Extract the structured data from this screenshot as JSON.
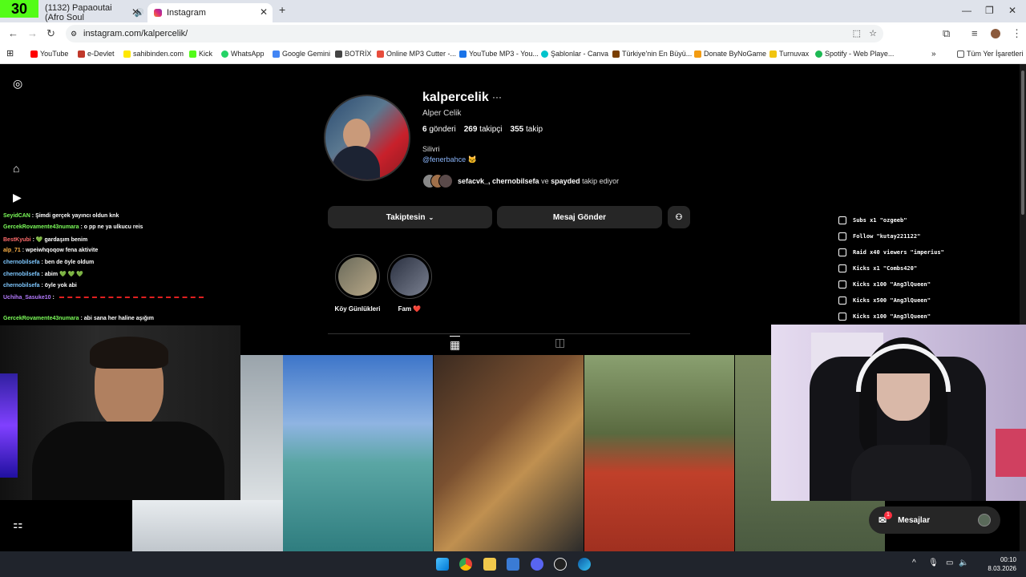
{
  "browser": {
    "k30_badge": "30",
    "tabs": [
      {
        "title": "(1132) Papaoutai (Afro Soul"
      },
      {
        "title": "Instagram"
      }
    ],
    "new_tab": "+",
    "url": "instagram.com/kalpercelik/",
    "bookmarks": [
      {
        "label": "YouTube",
        "color": "#ff0000"
      },
      {
        "label": "e-Devlet",
        "color": "#c0392b"
      },
      {
        "label": "sahibinden.com",
        "color": "#ffe800"
      },
      {
        "label": "Kick",
        "color": "#53fc18"
      },
      {
        "label": "WhatsApp",
        "color": "#25d366"
      },
      {
        "label": "Google Gemini",
        "color": "#4285f4"
      },
      {
        "label": "BOTRİX",
        "color": "#444444"
      },
      {
        "label": "Online MP3 Cutter -...",
        "color": "#e74c3c"
      },
      {
        "label": "YouTube MP3 - You...",
        "color": "#1a73e8"
      },
      {
        "label": "Şablonlar - Canva",
        "color": "#00c4cc"
      },
      {
        "label": "Türkiye'nin En Büyü...",
        "color": "#7b3f00"
      },
      {
        "label": "Donate ByNoGame",
        "color": "#f39c12"
      },
      {
        "label": "Turnuvax",
        "color": "#f1c40f"
      },
      {
        "label": "Spotify - Web Playe...",
        "color": "#1db954"
      }
    ],
    "all_bookmarks": "Tüm Yer İşaretleri"
  },
  "profile": {
    "username": "kalpercelik",
    "full_name": "Alper Celik",
    "posts_count": "6",
    "posts_label": "gönderi",
    "followers_count": "269",
    "followers_label": "takipçi",
    "following_count": "355",
    "following_label": "takip",
    "bio": "Silivri",
    "bio_link": "@fenerbahce 🐱",
    "followed_by_names": "sefacvk_, chernobilsefa",
    "followed_by_joiner": "ve",
    "followed_by_last": "spayded",
    "followed_by_suffix": "takip ediyor",
    "following_button": "Takiptesin",
    "message_button": "Mesaj Gönder",
    "highlights": [
      {
        "label": "Köy Günlükleri"
      },
      {
        "label": "Fam ❤️"
      }
    ],
    "grid_tab_icon": "grid-icon",
    "tagged_tab_icon": "tagged-icon",
    "messages_label": "Mesajlar",
    "messages_badge": "1"
  },
  "chat": [
    {
      "user": "SeyidCAN",
      "msg": ": Şimdi gerçek yayıncı oldun knk"
    },
    {
      "user": "GercekRovamente43numara",
      "msg": ": o pp ne ya ulkucu reis"
    },
    {
      "user": "BestKyubi",
      "msg": ": 💚 gardaşım benim"
    },
    {
      "user": "alp_71",
      "msg": ": wpeiwhqoqow fena aktivite"
    },
    {
      "user": "chernobilsefa",
      "msg": ": ben de öyle oldum"
    },
    {
      "user": "chernobilsefa",
      "msg": ": abim 💚 💚 💚"
    },
    {
      "user": "chernobilsefa",
      "msg": ": öyle yok abi"
    },
    {
      "user": "Uchiha_Sasuke10",
      "msg": ":"
    },
    {
      "user": "GercekRovamente43numara",
      "msg": ": abi sana her haline aşığım"
    }
  ],
  "alerts": [
    {
      "text": "Subs x1 \"ozgeeb\""
    },
    {
      "text": "Follow \"kutay221122\""
    },
    {
      "text": "Raid x40 viewers \"imperius\""
    },
    {
      "text": "Kicks x1 \"Combs420\""
    },
    {
      "text": "Kicks x100 \"Ang3lQueen\""
    },
    {
      "text": "Kicks x500 \"Ang3lQueen\""
    },
    {
      "text": "Kicks x100 \"Ang3lQueen\""
    }
  ],
  "taskbar": {
    "time": "00:10",
    "date": "8.03.2026"
  }
}
